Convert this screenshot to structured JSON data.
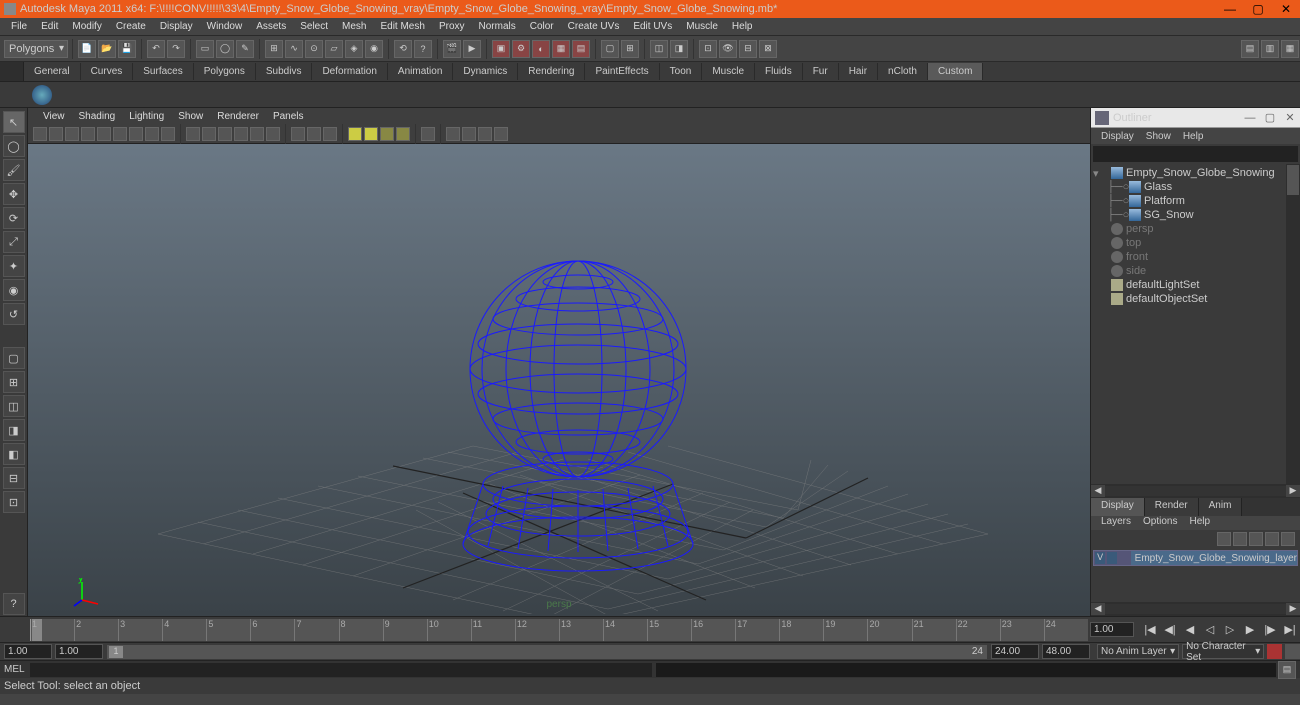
{
  "title": "Autodesk Maya 2011 x64: F:\\!!!!CONV!!!!!\\33\\4\\Empty_Snow_Globe_Snowing_vray\\Empty_Snow_Globe_Snowing_vray\\Empty_Snow_Globe_Snowing.mb*",
  "menubar": [
    "File",
    "Edit",
    "Modify",
    "Create",
    "Display",
    "Window",
    "Assets",
    "Select",
    "Mesh",
    "Edit Mesh",
    "Proxy",
    "Normals",
    "Color",
    "Create UVs",
    "Edit UVs",
    "Muscle",
    "Help"
  ],
  "mode_dropdown": "Polygons",
  "shelf_tabs": [
    "General",
    "Curves",
    "Surfaces",
    "Polygons",
    "Subdivs",
    "Deformation",
    "Animation",
    "Dynamics",
    "Rendering",
    "PaintEffects",
    "Toon",
    "Muscle",
    "Fluids",
    "Fur",
    "Hair",
    "nCloth",
    "Custom"
  ],
  "shelf_active": "Custom",
  "view_menu": [
    "View",
    "Shading",
    "Lighting",
    "Show",
    "Renderer",
    "Panels"
  ],
  "persp_label": "persp",
  "outliner": {
    "title": "Outliner",
    "menu": [
      "Display",
      "Show",
      "Help"
    ],
    "items": [
      {
        "indent": 0,
        "icon": "mesh",
        "label": "Empty_Snow_Globe_Snowing",
        "exp": true
      },
      {
        "indent": 1,
        "icon": "mesh",
        "label": "Glass",
        "branch": true
      },
      {
        "indent": 1,
        "icon": "mesh",
        "label": "Platform",
        "branch": true
      },
      {
        "indent": 1,
        "icon": "mesh",
        "label": "SG_Snow",
        "branch": true
      },
      {
        "indent": 0,
        "icon": "cam",
        "label": "persp",
        "dim": true
      },
      {
        "indent": 0,
        "icon": "cam",
        "label": "top",
        "dim": true
      },
      {
        "indent": 0,
        "icon": "cam",
        "label": "front",
        "dim": true
      },
      {
        "indent": 0,
        "icon": "cam",
        "label": "side",
        "dim": true
      },
      {
        "indent": 0,
        "icon": "set",
        "label": "defaultLightSet"
      },
      {
        "indent": 0,
        "icon": "set",
        "label": "defaultObjectSet"
      }
    ]
  },
  "layer_tabs": [
    "Display",
    "Render",
    "Anim"
  ],
  "layer_active": "Display",
  "layer_menu": [
    "Layers",
    "Options",
    "Help"
  ],
  "layer_row": {
    "vis": "V",
    "label": "Empty_Snow_Globe_Snowing_layer"
  },
  "timeline": {
    "ticks": [
      "1",
      "2",
      "3",
      "4",
      "5",
      "6",
      "7",
      "8",
      "9",
      "10",
      "11",
      "12",
      "13",
      "14",
      "15",
      "16",
      "17",
      "18",
      "19",
      "20",
      "21",
      "22",
      "23",
      "24"
    ]
  },
  "range": {
    "start_outer": "1.00",
    "start_inner": "1.00",
    "cur": "1",
    "end_label": "24",
    "end_inner": "24.00",
    "end_outer": "48.00"
  },
  "time_box": "1.00",
  "anim_layer_dd": "No Anim Layer",
  "char_set_dd": "No Character Set",
  "cmd_label": "MEL",
  "status": "Select Tool: select an object"
}
